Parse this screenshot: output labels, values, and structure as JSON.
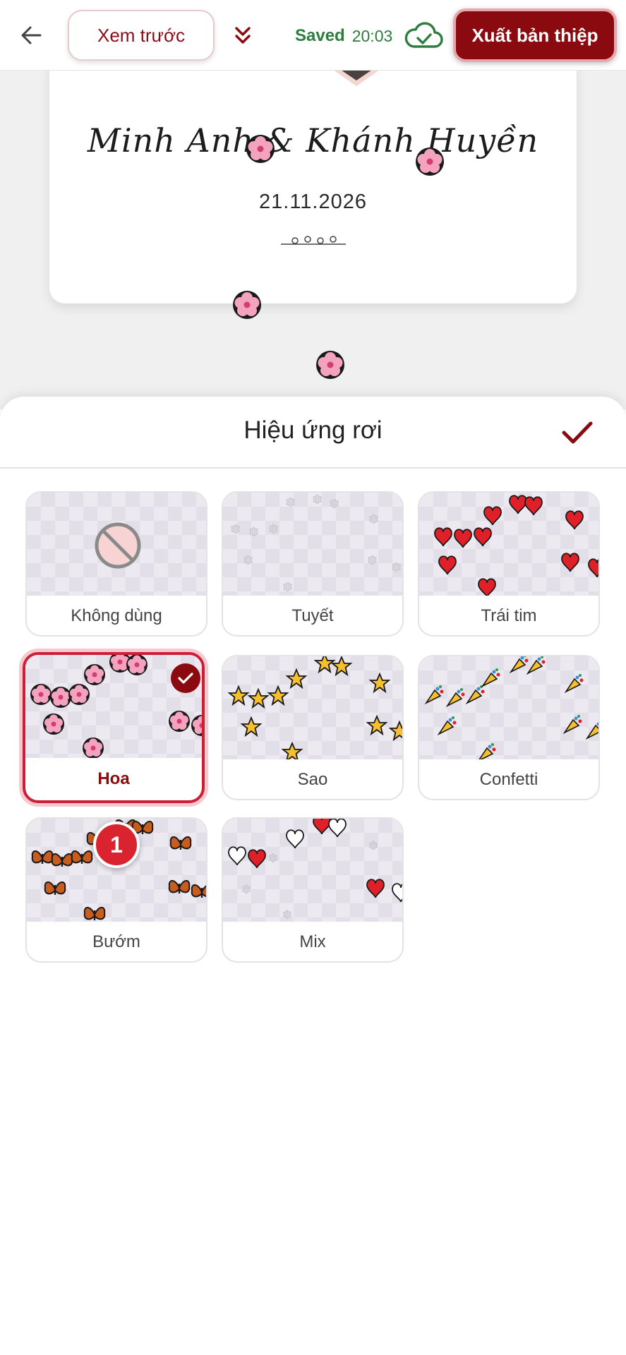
{
  "topbar": {
    "preview_label": "Xem trước",
    "saved_label": "Saved",
    "saved_time": "20:03",
    "export_label": "Xuất bản thiệp"
  },
  "invitation": {
    "names": "Minh Anh & Khánh Huyền",
    "date": "21.11.2026"
  },
  "sheet": {
    "title": "Hiệu ứng rơi",
    "options": [
      {
        "label": "Không dùng",
        "selected": false
      },
      {
        "label": "Tuyết",
        "selected": false
      },
      {
        "label": "Trái tim",
        "selected": false
      },
      {
        "label": "Hoa",
        "selected": true
      },
      {
        "label": "Sao",
        "selected": false
      },
      {
        "label": "Confetti",
        "selected": false
      },
      {
        "label": "Bướm",
        "selected": false
      },
      {
        "label": "Mix",
        "selected": false
      }
    ],
    "step_badge": "1"
  },
  "colors": {
    "brand": "#8b0a0f",
    "saved": "#2e7d3e",
    "highlight": "#cc1f36"
  }
}
